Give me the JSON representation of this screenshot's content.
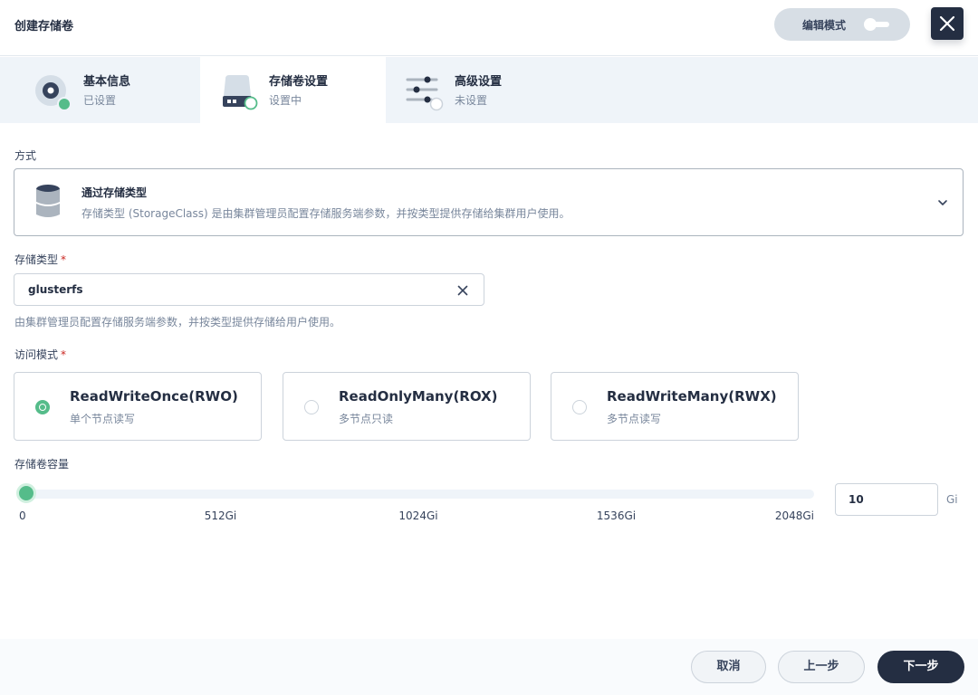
{
  "header": {
    "title": "创建存储卷",
    "edit_mode_label": "编辑模式",
    "edit_mode_on": false
  },
  "steps": [
    {
      "title": "基本信息",
      "status": "已设置",
      "icon": "disk-icon"
    },
    {
      "title": "存储卷设置",
      "status": "设置中",
      "icon": "drive-icon"
    },
    {
      "title": "高级设置",
      "status": "未设置",
      "icon": "sliders-icon"
    }
  ],
  "form": {
    "method_label": "方式",
    "method": {
      "title": "通过存储类型",
      "description": "存储类型 (StorageClass) 是由集群管理员配置存储服务端参数，并按类型提供存储给集群用户使用。",
      "icon": "database-icon"
    },
    "storage_class_label": "存储类型",
    "storage_class_value": "glusterfs",
    "storage_class_hint": "由集群管理员配置存储服务端参数，并按类型提供存储给用户使用。",
    "access_mode_label": "访问模式",
    "access_modes": [
      {
        "title": "ReadWriteOnce(RWO)",
        "subtitle": "单个节点读写",
        "selected": true
      },
      {
        "title": "ReadOnlyMany(ROX)",
        "subtitle": "多节点只读",
        "selected": false
      },
      {
        "title": "ReadWriteMany(RWX)",
        "subtitle": "多节点读写",
        "selected": false
      }
    ],
    "capacity_label": "存储卷容量",
    "capacity_value": "10",
    "capacity_unit": "Gi",
    "capacity_max": 2048,
    "capacity_marks": [
      "0",
      "512Gi",
      "1024Gi",
      "1536Gi",
      "2048Gi"
    ]
  },
  "footer": {
    "cancel": "取消",
    "prev": "上一步",
    "next": "下一步"
  },
  "colors": {
    "accent": "#55bc8a",
    "dark": "#242e42",
    "required": "#ca2621"
  }
}
